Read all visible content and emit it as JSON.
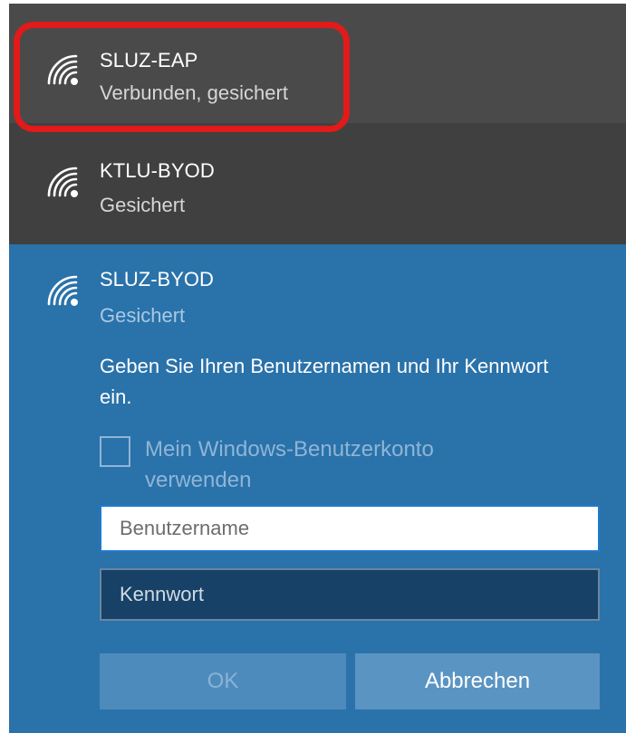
{
  "networks": [
    {
      "name": "SLUZ-EAP",
      "status": "Verbunden, gesichert"
    },
    {
      "name": "KTLU-BYOD",
      "status": "Gesichert"
    }
  ],
  "expanded_network": {
    "name": "SLUZ-BYOD",
    "status": "Gesichert",
    "prompt": "Geben Sie Ihren Benutzernamen und Ihr Kennwort ein.",
    "checkbox_label": "Mein Windows-Benutzerkonto verwenden",
    "checkbox_checked": false,
    "username": {
      "placeholder": "Benutzername",
      "value": ""
    },
    "password": {
      "placeholder": "Kennwort",
      "value": ""
    },
    "ok_label": "OK",
    "cancel_label": "Abbrechen"
  },
  "colors": {
    "expanded_bg": "#2a72aa",
    "highlight": "#e11a1a"
  }
}
